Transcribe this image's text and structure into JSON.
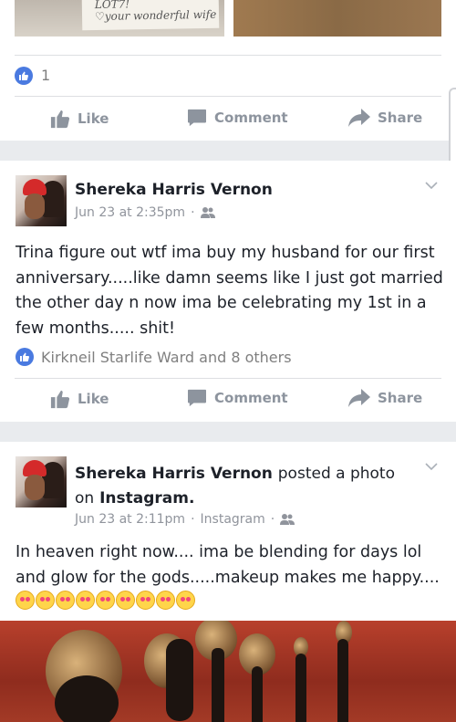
{
  "top_post": {
    "photo_note_text": "LOT7!\n♡your wonderful wife",
    "reaction_count": "1",
    "actions": {
      "like": "Like",
      "comment": "Comment",
      "share": "Share"
    }
  },
  "post1": {
    "author": "Shereka Harris Vernon",
    "timestamp": "Jun 23 at 2:35pm",
    "body": "Trina figure out wtf ima buy my husband for our first anniversary.....like damn seems like I just got married the other day n now ima be celebrating my 1st  in a few months..... shit!",
    "reactions_text": "Kirkneil Starlife Ward and 8 others",
    "actions": {
      "like": "Like",
      "comment": "Comment",
      "share": "Share"
    }
  },
  "post2": {
    "author": "Shereka Harris Vernon",
    "action_text": "posted a photo",
    "on_text": "on",
    "platform": "Instagram.",
    "timestamp": "Jun 23 at 2:11pm",
    "source": "Instagram",
    "body": "In heaven right now.... ima be blending for  days lol and glow for the gods.....makeup makes me happy....",
    "emoji_count": 9
  },
  "colors": {
    "accent": "#4a7ae0",
    "muted": "#90949c",
    "action": "#8d949e"
  }
}
